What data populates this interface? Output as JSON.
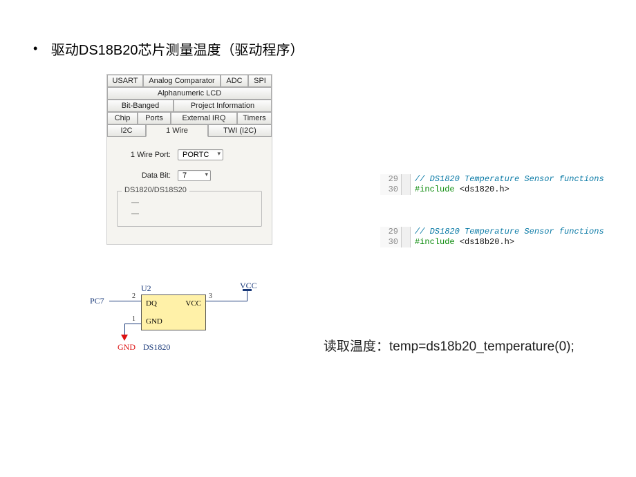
{
  "bullet": {
    "text": "驱动DS18B20芯片测量温度（驱动程序）"
  },
  "config_panel": {
    "row1": {
      "usart": "USART",
      "analog": "Analog Comparator",
      "adc": "ADC",
      "spi": "SPI"
    },
    "row2": {
      "lcd": "Alphanumeric LCD"
    },
    "row3": {
      "bitbanged": "Bit-Banged",
      "projinfo": "Project Information"
    },
    "row4": {
      "chip": "Chip",
      "ports": "Ports",
      "extirq": "External IRQ",
      "timers": "Timers"
    },
    "row5": {
      "i2c": "I2C",
      "onewire": "1 Wire",
      "twi": "TWI (I2C)"
    },
    "wire_port": {
      "label": "1 Wire Port:",
      "value": "PORTC"
    },
    "data_bit": {
      "label": "Data Bit:",
      "value": "7"
    },
    "groupbox": {
      "title": "DS1820/DS18S20",
      "line1": "—",
      "line2": "—"
    }
  },
  "code1": {
    "l29": {
      "num": "29",
      "comment": "// DS1820 Temperature Sensor functions"
    },
    "l30": {
      "num": "30",
      "include": "#include",
      "file": "<ds1820.h>"
    }
  },
  "code2": {
    "l29": {
      "num": "29",
      "comment": "// DS1820 Temperature Sensor functions"
    },
    "l30": {
      "num": "30",
      "include": "#include",
      "file": "<ds18b20.h>"
    }
  },
  "schematic": {
    "u2": "U2",
    "pc7": "PC7",
    "vcc": "VCC",
    "gnd": "GND",
    "part": "DS1820",
    "pin_dq": "DQ",
    "pin_vcc": "VCC",
    "pin_gnd": "GND",
    "pin1": "1",
    "pin2": "2",
    "pin3": "3"
  },
  "read_temp": "读取温度：temp=ds18b20_temperature(0);"
}
